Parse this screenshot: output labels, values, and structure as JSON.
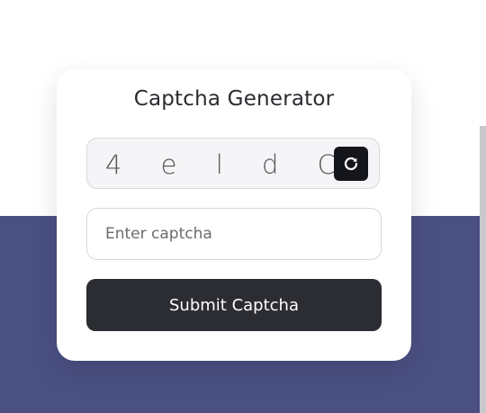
{
  "card": {
    "title": "Captcha Generator"
  },
  "captcha": {
    "code": "4 e l d C",
    "refresh_icon": "refresh-icon"
  },
  "input": {
    "placeholder": "Enter captcha",
    "value": ""
  },
  "submit": {
    "label": "Submit Captcha"
  },
  "colors": {
    "band": "#4a5082",
    "button_dark": "#2c2d33",
    "refresh_bg": "#15161b"
  }
}
